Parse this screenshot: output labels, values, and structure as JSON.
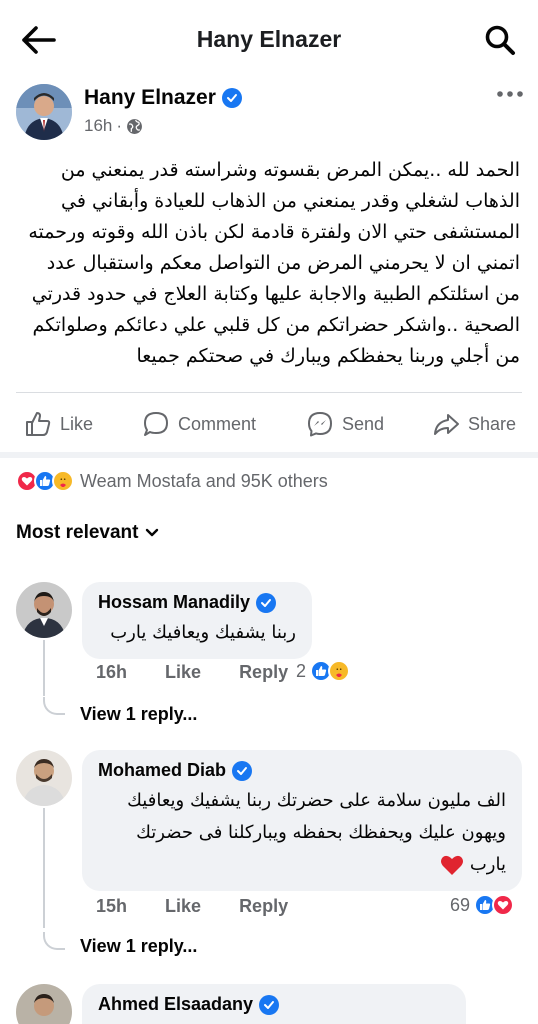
{
  "header": {
    "title": "Hany Elnazer"
  },
  "post": {
    "author": "Hany Elnazer",
    "time": "16h",
    "audience_icon": "globe-icon",
    "text": "الحمد لله ..يمكن المرض بقسوته وشراسته قدر يمنعني من الذهاب لشغلي وقدر يمنعني من الذهاب للعيادة وأبقاني في المستشفى حتي الان ولفترة قادمة  لكن باذن الله وقوته ورحمته اتمني ان لا يحرمني  المرض من التواصل معكم  واستقبال عدد من اسئلتكم الطبية والاجابة عليها وكتابة العلاج في حدود قدرتي الصحية ..واشكر حضراتكم من كل قلبي علي دعائكم وصلواتكم من أجلي وربنا يحفظكم ويبارك في صحتكم جميعا"
  },
  "actions": {
    "like": "Like",
    "comment": "Comment",
    "send": "Send",
    "share": "Share"
  },
  "reactions": {
    "summary": "Weam Mostafa and 95K others"
  },
  "sort": {
    "label": "Most relevant"
  },
  "comments": [
    {
      "name": "Hossam Manadily",
      "text": "ربنا يشفيك ويعافيك يارب",
      "time": "16h",
      "like": "Like",
      "reply": "Reply",
      "count": "2",
      "view_replies": "View 1 reply..."
    },
    {
      "name": "Mohamed Diab",
      "text": "الف مليون سلامة على حضرتك ربنا يشفيك ويعافيك ويهون عليك ويحفظك بحفظه ويباركلنا فى حضرتك يارب",
      "time": "15h",
      "like": "Like",
      "reply": "Reply",
      "count": "69",
      "view_replies": "View 1 reply..."
    },
    {
      "name": "Ahmed Elsaadany"
    }
  ],
  "colors": {
    "brand_blue": "#1877f2",
    "love_red": "#f02849",
    "care_yellow": "#f7b928",
    "secondary_text": "#65676b",
    "bubble_bg": "#f0f2f5"
  }
}
